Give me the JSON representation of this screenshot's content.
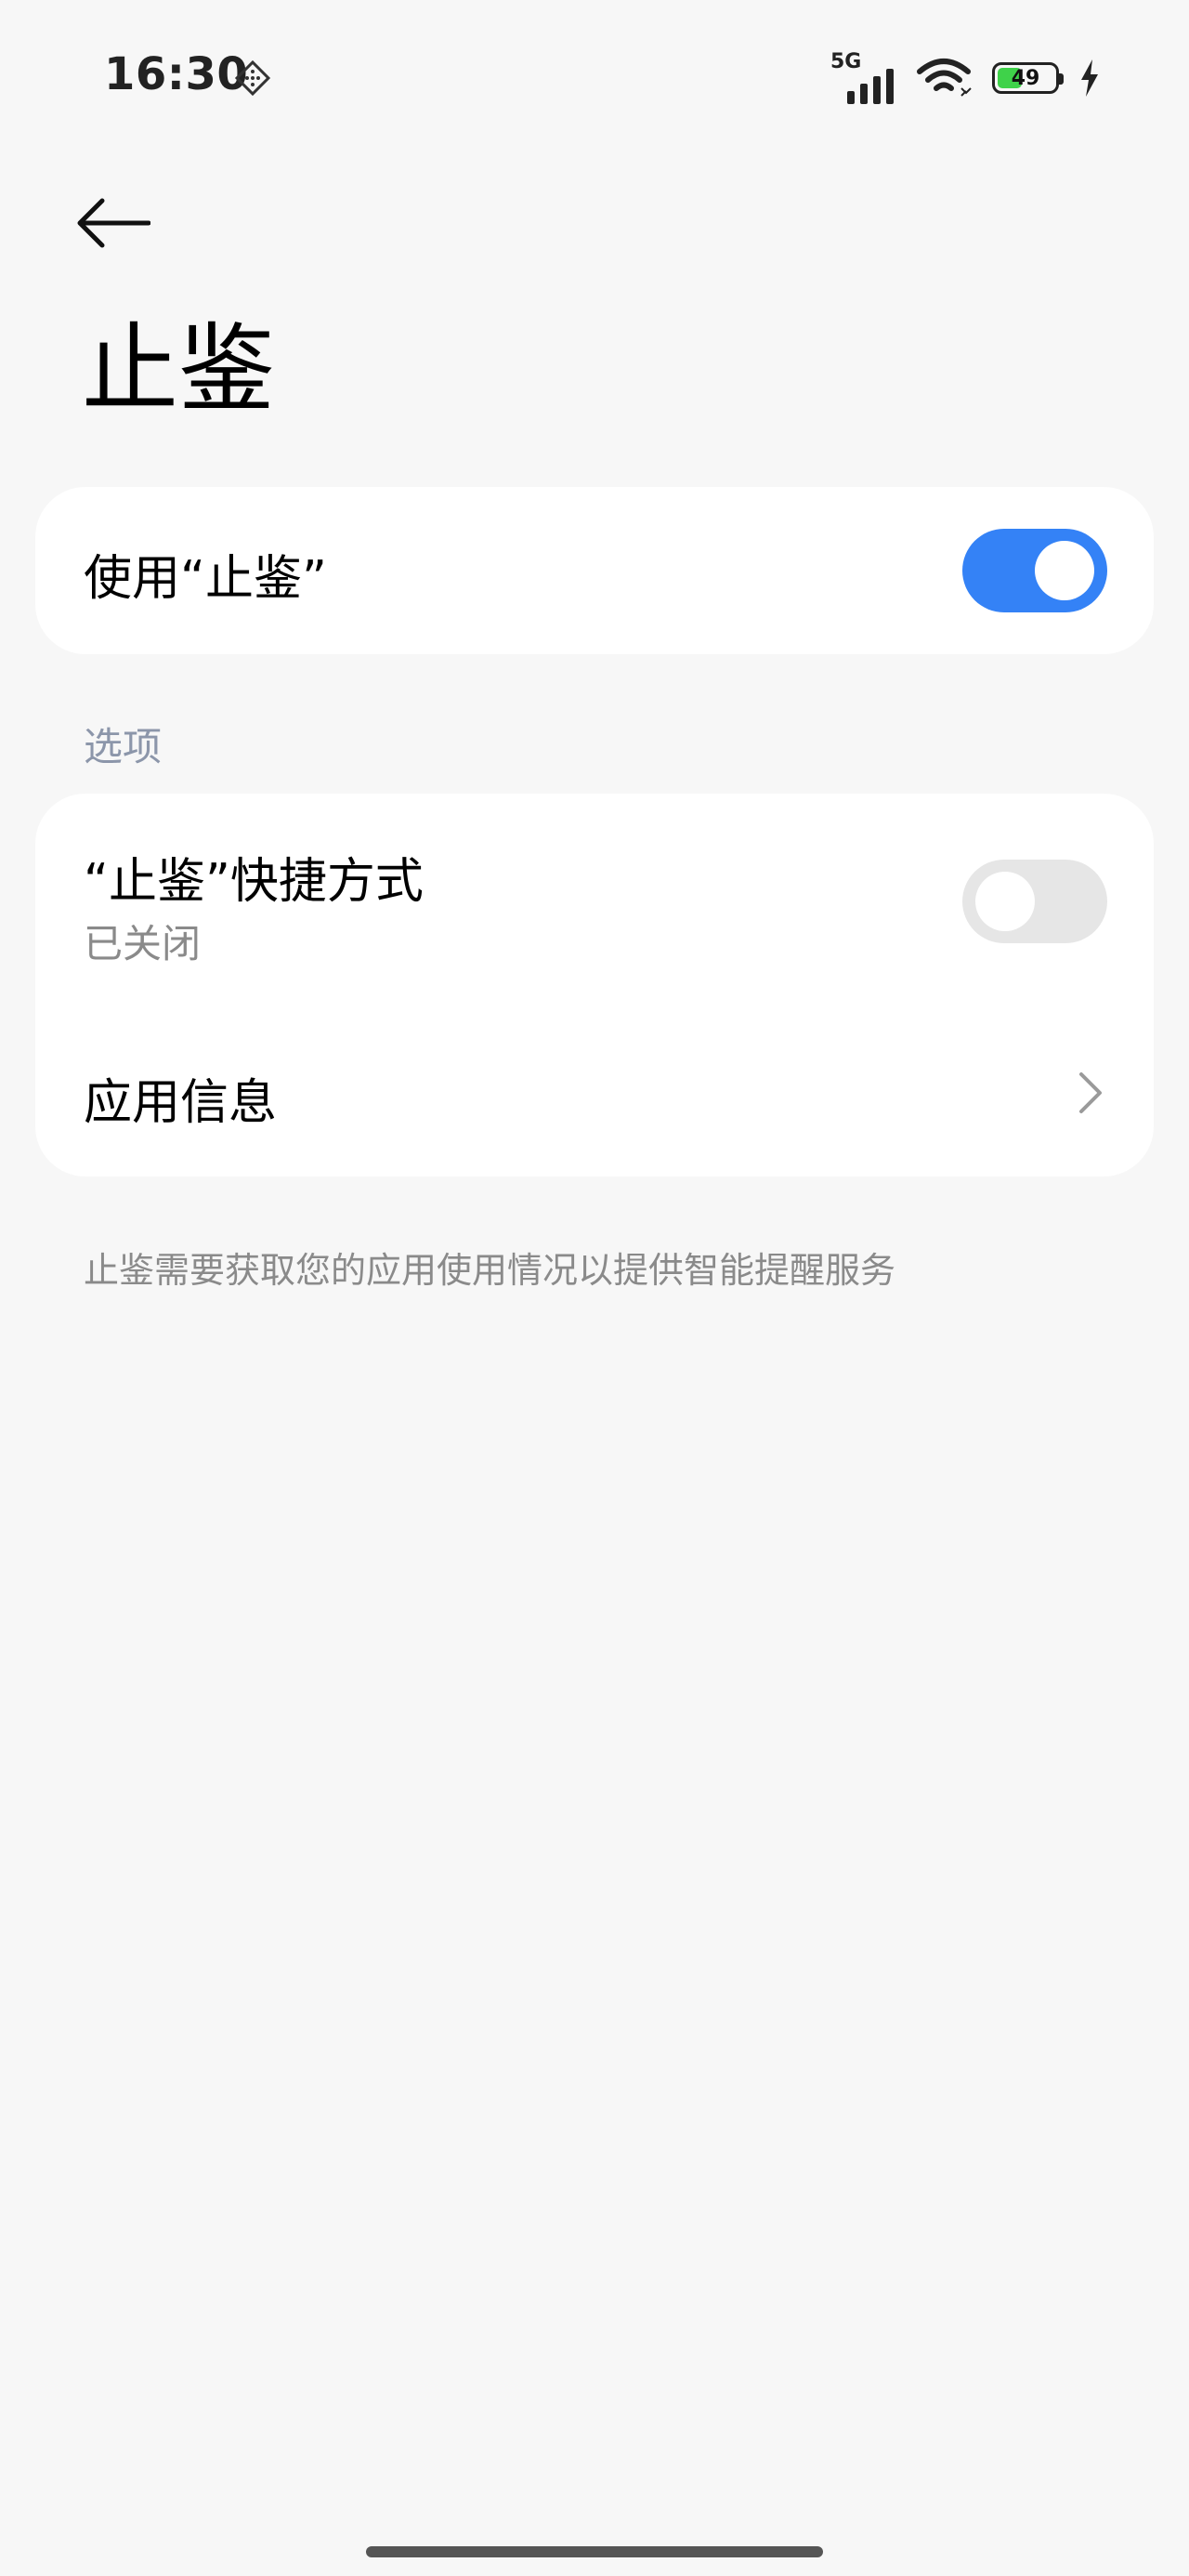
{
  "status_bar": {
    "time": "16:30",
    "network": "5G",
    "battery_level": "49",
    "battery_percent": 49,
    "charging": true,
    "icons": [
      "dnd-diamond-icon",
      "signal-icon",
      "wifi-icon",
      "battery-icon",
      "charging-bolt-icon"
    ]
  },
  "header": {
    "back_icon": "arrow-left-icon",
    "title": "止鉴"
  },
  "main_card": {
    "enable_label": "使用“止鉴”",
    "enable_on": true
  },
  "options": {
    "section_label": "选项",
    "shortcut_label": "“止鉴”快捷方式",
    "shortcut_status": "已关闭",
    "shortcut_on": false,
    "app_info_label": "应用信息",
    "app_info_icon": "chevron-right-icon"
  },
  "footer": {
    "note": "止鉴需要获取您的应用使用情况以提供智能提醒服务"
  },
  "colors": {
    "background": "#f7f7f7",
    "card": "#ffffff",
    "accent": "#3482f6",
    "toggle_off": "#e6e6e6",
    "secondary_text": "#8a8a8a",
    "section_label": "#8c96aa",
    "battery_fill": "#3fd24a"
  }
}
